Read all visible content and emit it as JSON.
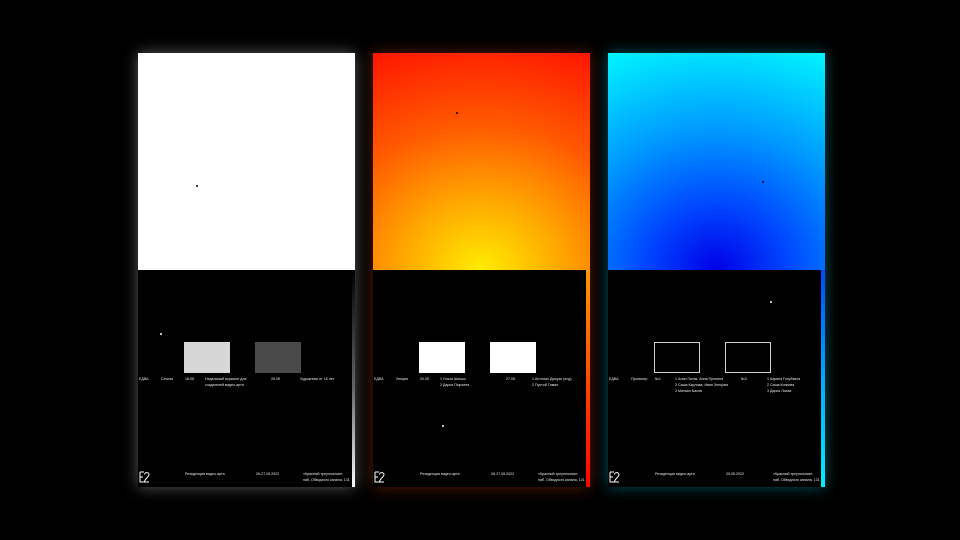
{
  "posters": [
    {
      "col1": "ЕДВА",
      "col2": "Сессия",
      "date_a": "18.05",
      "desc_a": [
        "Недельный воркшоп для",
        "создателей видео-арта"
      ],
      "date_b": "25.05",
      "desc_b": "Художники от 18 лет",
      "footer_title": "Резиденция видео-арта",
      "footer_dates": "26-27.05.2022",
      "footer_place": [
        "«Красный треугольник»,",
        "наб. Обводного канала, 131"
      ]
    },
    {
      "col1": "ЕДВА",
      "col2": "Лекция",
      "date_a": "20.05",
      "list_a": [
        "1  Ольга Шишко",
        "2  Дарья Пырхина"
      ],
      "date_b": "27.05",
      "list_b": [
        "1  Антонио Джоузо (eng)",
        "2  Пустой Тимин"
      ],
      "footer_title": "Резиденция видео-арта",
      "footer_dates": "26-27.05.2022",
      "footer_place": [
        "«Красный треугольник»,",
        "наб. Обводного канала, 131"
      ]
    },
    {
      "col1": "ЕДВА",
      "col2": "Просмотр",
      "label_a": "№1",
      "list_a": [
        "1  Алин Питак, Анна Пронина",
        "2  Саша Карлова, Иван Зенцова",
        "3  Михаил Басов"
      ],
      "label_b": "№2",
      "list_b": [
        "1  Карина Голубкина",
        "2  Саша Копьева",
        "3  Дарья Лихая"
      ],
      "footer_title": "Резиденция видео-арта",
      "footer_dates": "29.05.2022",
      "footer_place": [
        "«Красный треугольник»,",
        "наб. Обводного канала, 131"
      ]
    }
  ],
  "colors": {
    "background": "#000000",
    "poster1_top": "#ffffff",
    "poster2_top_outer": "#ff0c00",
    "poster2_top_center": "#ffec00",
    "poster3_top_outer": "#00f6ff",
    "poster3_top_center": "#0000e8"
  }
}
